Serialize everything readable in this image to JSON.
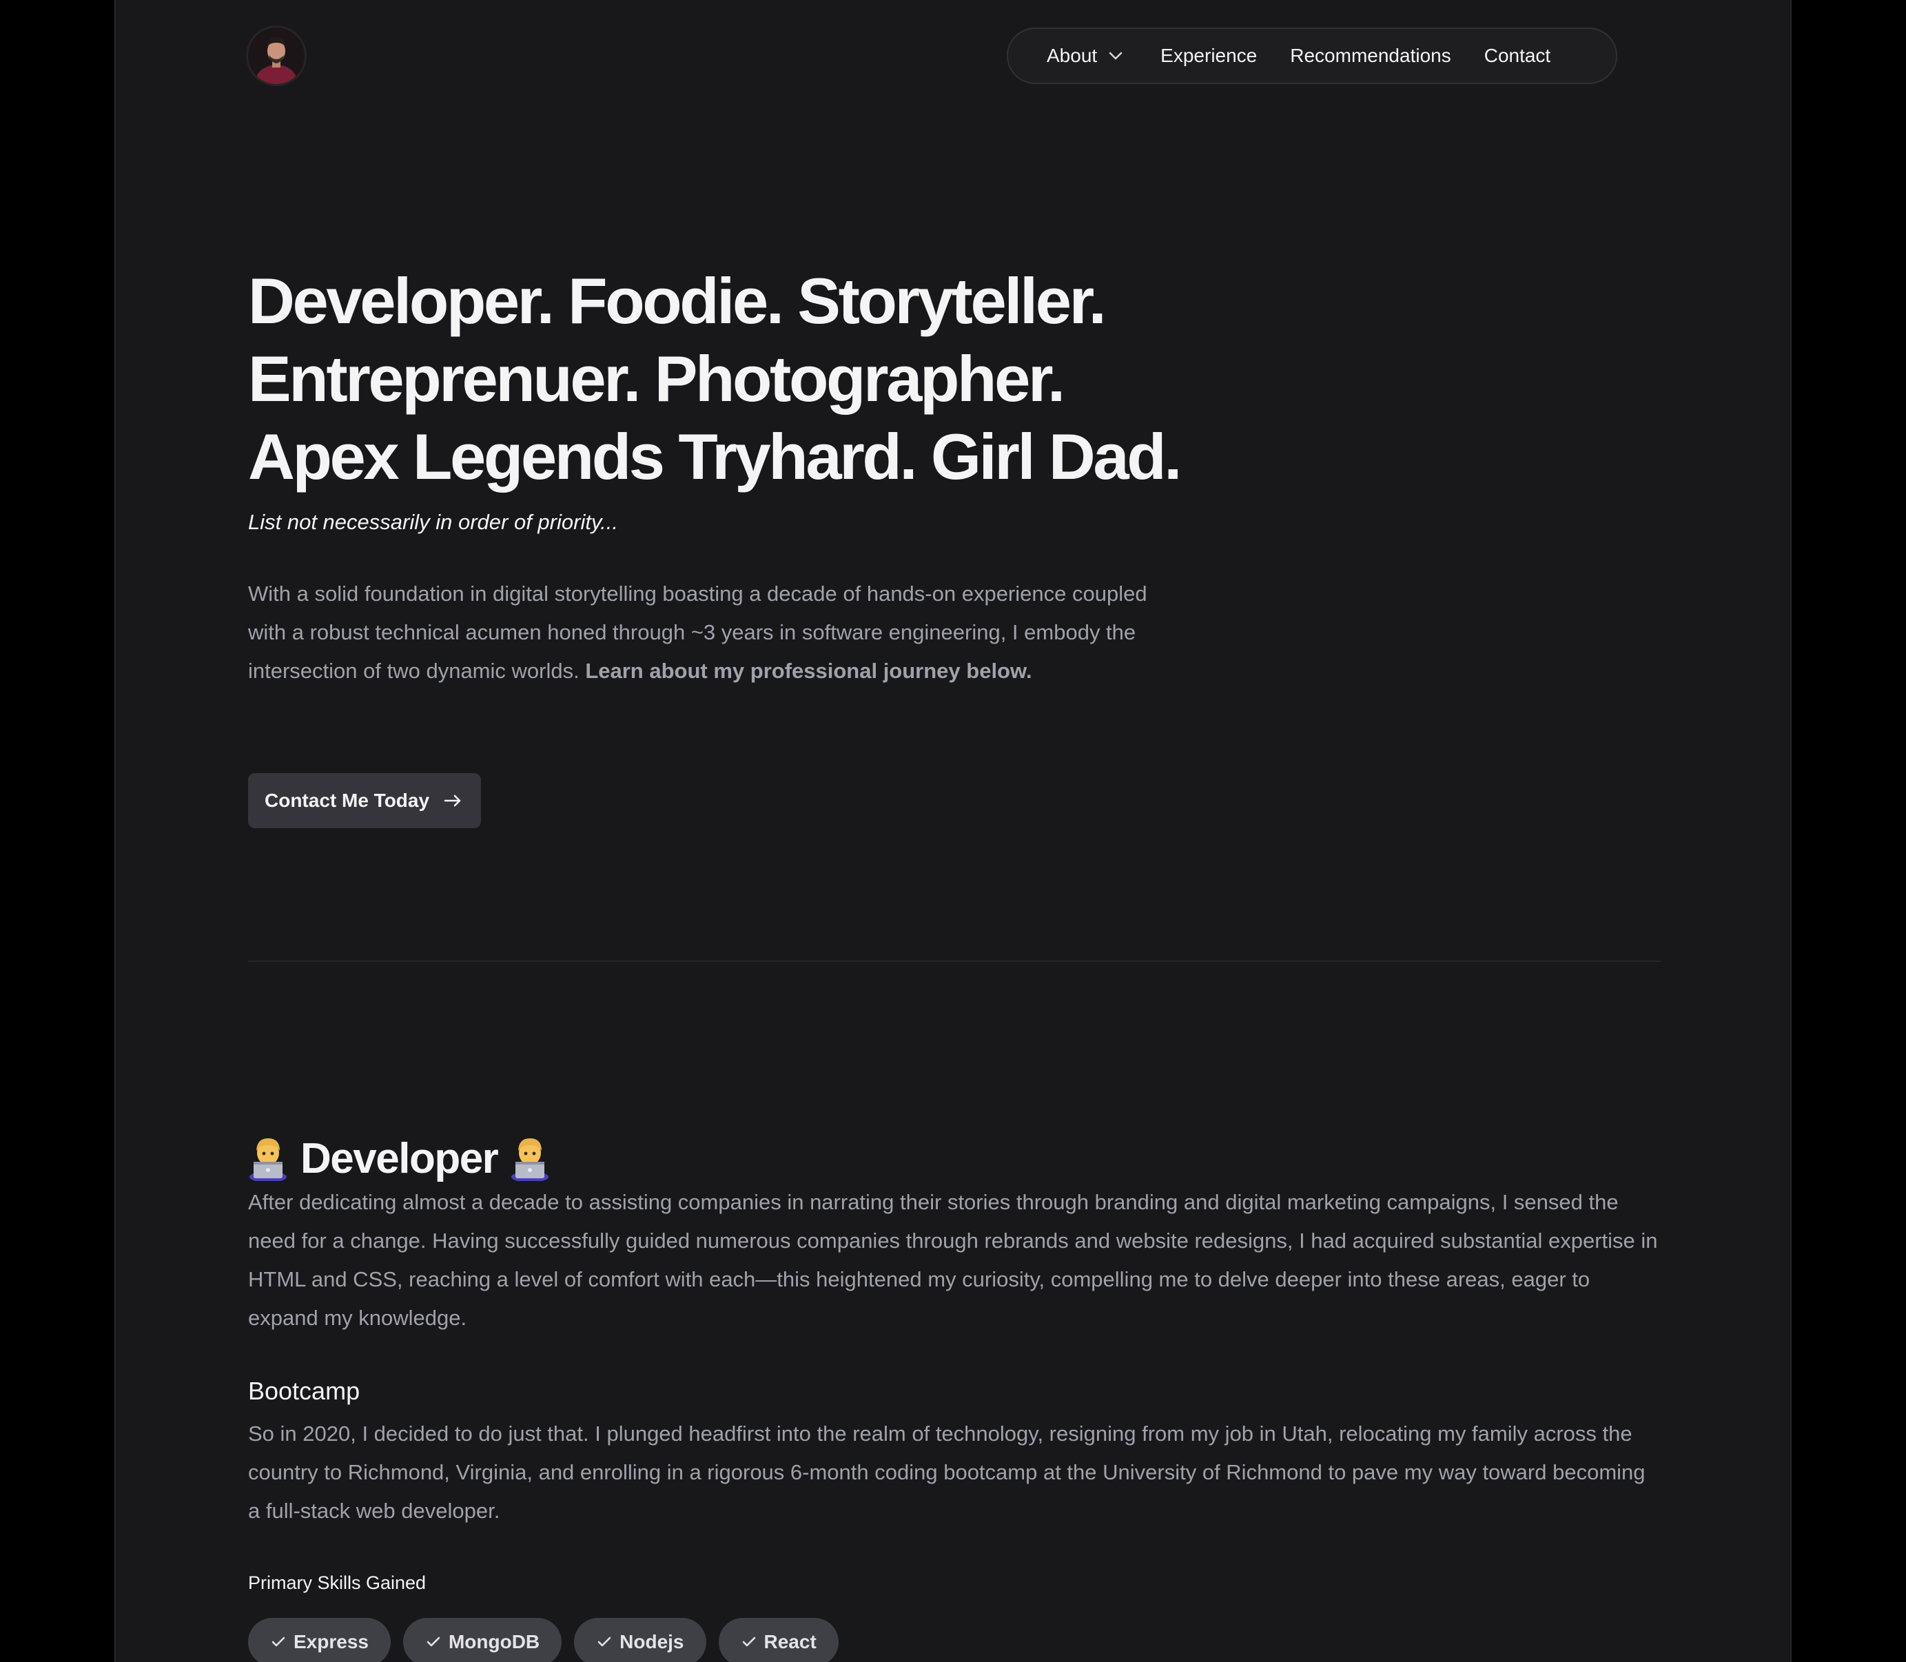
{
  "header": {
    "avatar_alt": "Profile photo",
    "nav": {
      "about": "About",
      "experience": "Experience",
      "recommendations": "Recommendations",
      "contact": "Contact"
    }
  },
  "hero": {
    "title_lines": [
      "Developer. Foodie. Storyteller.",
      "Entreprenuer. Photographer.",
      "Apex Legends Tryhard. Girl Dad."
    ],
    "subtitle": "List not necessarily in order of priority...",
    "body": "With a solid foundation in digital storytelling boasting a decade of hands-on experience coupled with a robust technical acumen honed through ~3 years in software engineering, I embody the intersection of two dynamic worlds.",
    "body_bold": "Learn about my professional journey below.",
    "cta_label": "Contact Me Today"
  },
  "developer": {
    "heading": "Developer",
    "emoji": "technologist",
    "intro": "After dedicating almost a decade to assisting companies in narrating their stories through branding and digital marketing campaigns, I sensed the need for a change. Having successfully guided numerous companies through rebrands and website redesigns, I had acquired substantial expertise in HTML and CSS, reaching a level of comfort with each—this heightened my curiosity, compelling me to delve deeper into these areas, eager to expand my knowledge.",
    "bootcamp_title": "Bootcamp",
    "bootcamp_body": "So in 2020, I decided to do just that. I plunged headfirst into the realm of technology, resigning from my job in Utah, relocating my family across the country to Richmond, Virginia, and enrolling in a rigorous 6-month coding bootcamp at the University of Richmond to pave my way toward becoming a full-stack web developer.",
    "skills_label": "Primary Skills Gained",
    "skills": [
      "Express",
      "MongoDB",
      "Nodejs",
      "React"
    ]
  },
  "colors": {
    "page_bg": "#18181b",
    "outer_bg": "#000000",
    "text_primary": "#f4f4f5",
    "text_secondary": "#a1a1aa",
    "button_bg": "#35353b",
    "chip_bg": "#3f3f46"
  }
}
